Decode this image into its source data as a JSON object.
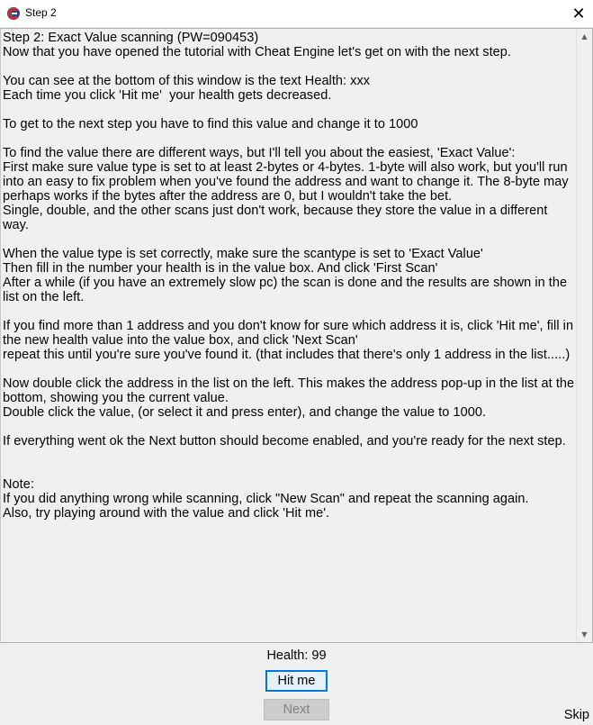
{
  "window": {
    "title": "Step 2",
    "close_glyph": "✕"
  },
  "tutorial": {
    "text": "Step 2: Exact Value scanning (PW=090453)\nNow that you have opened the tutorial with Cheat Engine let's get on with the next step.\n\nYou can see at the bottom of this window is the text Health: xxx\nEach time you click 'Hit me'  your health gets decreased.\n\nTo get to the next step you have to find this value and change it to 1000\n\nTo find the value there are different ways, but I'll tell you about the easiest, 'Exact Value':\nFirst make sure value type is set to at least 2-bytes or 4-bytes. 1-byte will also work, but you'll run into an easy to fix problem when you've found the address and want to change it. The 8-byte may perhaps works if the bytes after the address are 0, but I wouldn't take the bet.\nSingle, double, and the other scans just don't work, because they store the value in a different way.\n\nWhen the value type is set correctly, make sure the scantype is set to 'Exact Value'\nThen fill in the number your health is in the value box. And click 'First Scan'\nAfter a while (if you have an extremely slow pc) the scan is done and the results are shown in the list on the left.\n\nIf you find more than 1 address and you don't know for sure which address it is, click 'Hit me', fill in the new health value into the value box, and click 'Next Scan'\nrepeat this until you're sure you've found it. (that includes that there's only 1 address in the list.....)\n\nNow double click the address in the list on the left. This makes the address pop-up in the list at the bottom, showing you the current value.\nDouble click the value, (or select it and press enter), and change the value to 1000.\n\nIf everything went ok the Next button should become enabled, and you're ready for the next step.\n\n\nNote:\nIf you did anything wrong while scanning, click \"New Scan\" and repeat the scanning again.\nAlso, try playing around with the value and click 'Hit me'."
  },
  "scrollbar": {
    "up_glyph": "▲",
    "down_glyph": "▼"
  },
  "status": {
    "health_label": "Health: 99"
  },
  "buttons": {
    "hit_me": "Hit me",
    "next": "Next",
    "skip": "Skip"
  },
  "colors": {
    "focus_border": "#0078d7",
    "disabled_text": "#838383",
    "icon_red": "#d42a2a"
  }
}
